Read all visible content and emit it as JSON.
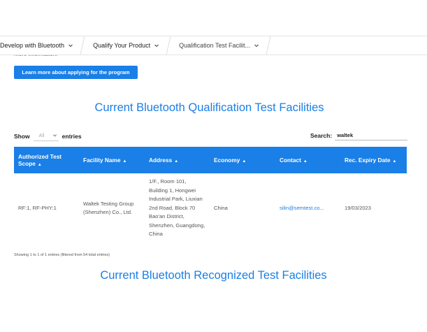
{
  "breadcrumb": {
    "items": [
      {
        "label": "Develop with Bluetooth"
      },
      {
        "label": "Qualify Your Product"
      },
      {
        "label": "Qualification Test Facilit..."
      }
    ]
  },
  "intro": {
    "clipped_text": "more information.",
    "button_label": "Learn more about applying for the program"
  },
  "section1": {
    "title": "Current Bluetooth Qualification Test Facilities"
  },
  "controls": {
    "show_label": "Show",
    "select_value": "All",
    "entries_label": "entries",
    "search_label": "Search:",
    "search_value": "waltek"
  },
  "table": {
    "headers": {
      "scope": "Authorized Test Scope",
      "name": "Facility Name",
      "address": "Address",
      "economy": "Economy",
      "contact": "Contact",
      "expiry": "Rec. Expiry Date"
    },
    "rows": [
      {
        "scope": "RF:1, RF-PHY:1",
        "name": "Waltek Testing Group (Shenzhen) Co., Ltd.",
        "address": "1/F., Room 101, Building 1, Hongwei Industrial Park, Liuxian 2nd Road, Block 70 Bao'an District, Shenzhen, Guangdong, China",
        "economy": "China",
        "contact": "silin@semtest.co...",
        "expiry": "19/03/2023"
      }
    ],
    "info": "Showing 1 to 1 of 1 entries (filtered from 54 total entries)"
  },
  "section2": {
    "title": "Current Bluetooth Recognized Test Facilities"
  },
  "colors": {
    "accent": "#1a7fe6"
  },
  "icons": {
    "chevron": "chevron-down-icon",
    "sort": "sort-arrow-icon"
  }
}
